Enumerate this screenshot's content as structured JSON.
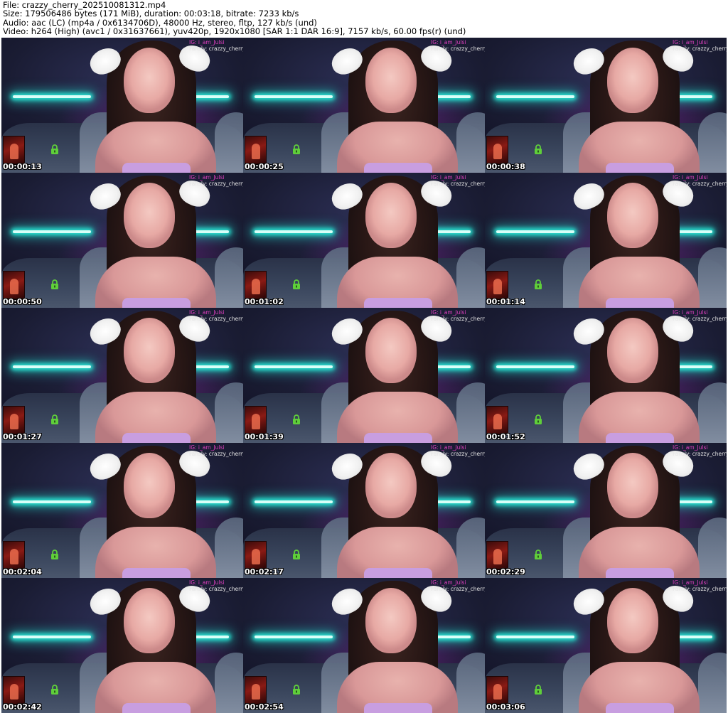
{
  "header": {
    "file_line": "File: crazzy_cherry_202510081312.mp4",
    "size_line": "Size: 179506486 bytes (171 MiB), duration: 00:03:18, bitrate: 7233 kb/s",
    "audio_line": "Audio: aac (LC) (mp4a / 0x6134706D), 48000 Hz, stereo, fltp, 127 kb/s (und)",
    "video_line": "Video: h264 (High) (avc1 / 0x31637661), yuv420p, 1920x1080 [SAR 1:1 DAR 16:9], 7157 kb/s, 60.00 fps(r) (und)"
  },
  "overlay": {
    "ig": "IG: i_am_Julsi",
    "fansly": "Fansly: crazzy_cherry"
  },
  "colors": {
    "neon": "#27e0d0",
    "overlay_ig": "#e040c0",
    "lock": "#5fcf3a"
  },
  "icons": {
    "lock": "lock-icon"
  },
  "frames": [
    {
      "timestamp": "00:00:13"
    },
    {
      "timestamp": "00:00:25"
    },
    {
      "timestamp": "00:00:38"
    },
    {
      "timestamp": "00:00:50"
    },
    {
      "timestamp": "00:01:02"
    },
    {
      "timestamp": "00:01:14"
    },
    {
      "timestamp": "00:01:27"
    },
    {
      "timestamp": "00:01:39"
    },
    {
      "timestamp": "00:01:52"
    },
    {
      "timestamp": "00:02:04"
    },
    {
      "timestamp": "00:02:17"
    },
    {
      "timestamp": "00:02:29"
    },
    {
      "timestamp": "00:02:42"
    },
    {
      "timestamp": "00:02:54"
    },
    {
      "timestamp": "00:03:06"
    }
  ]
}
